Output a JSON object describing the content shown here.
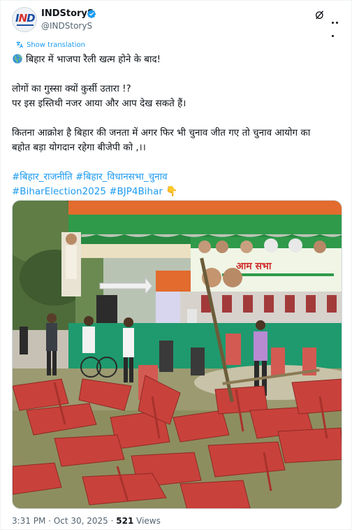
{
  "author": {
    "name": "INDStoryS",
    "handle": "@INDStoryS",
    "avatar_text": "IND"
  },
  "show_translation": "Show translation",
  "tweet": {
    "line1": "बिहार में भाजपा रैली खत्म होने के बाद!",
    "line2": " लोगों का गुस्सा क्यों कुर्सी उतारा !?",
    "line3": "पर इस इस्तिथी नजर आया और आप देख सकते हैं।",
    "line4": "कितना आक्रोश है बिहार की जनता में अगर फिर भी चुनाव जीत गए तो चुनाव आयोग का",
    "line5": "बहोत बड़ा योगदान रहेगा बीजेपी को ,।।",
    "hashtags": [
      "#बिहार_राजनीति",
      "#बिहार_विधानसभा_चुनाव",
      "#BiharElection2025",
      "#BJP4Bihar"
    ],
    "emoji": "👇"
  },
  "media": {
    "banner_text": "आम सभा"
  },
  "meta": {
    "time": "3:31 PM",
    "separator": " · ",
    "date": "Oct 30, 2025",
    "views_count": "521",
    "views_label": " Views"
  },
  "colors": {
    "link": "#1d9bf0",
    "muted": "#536471",
    "verified": "#1d9bf0"
  },
  "icons": [
    "verified-badge-icon",
    "grok-icon",
    "more-options-icon",
    "translate-icon",
    "globe-icon"
  ]
}
